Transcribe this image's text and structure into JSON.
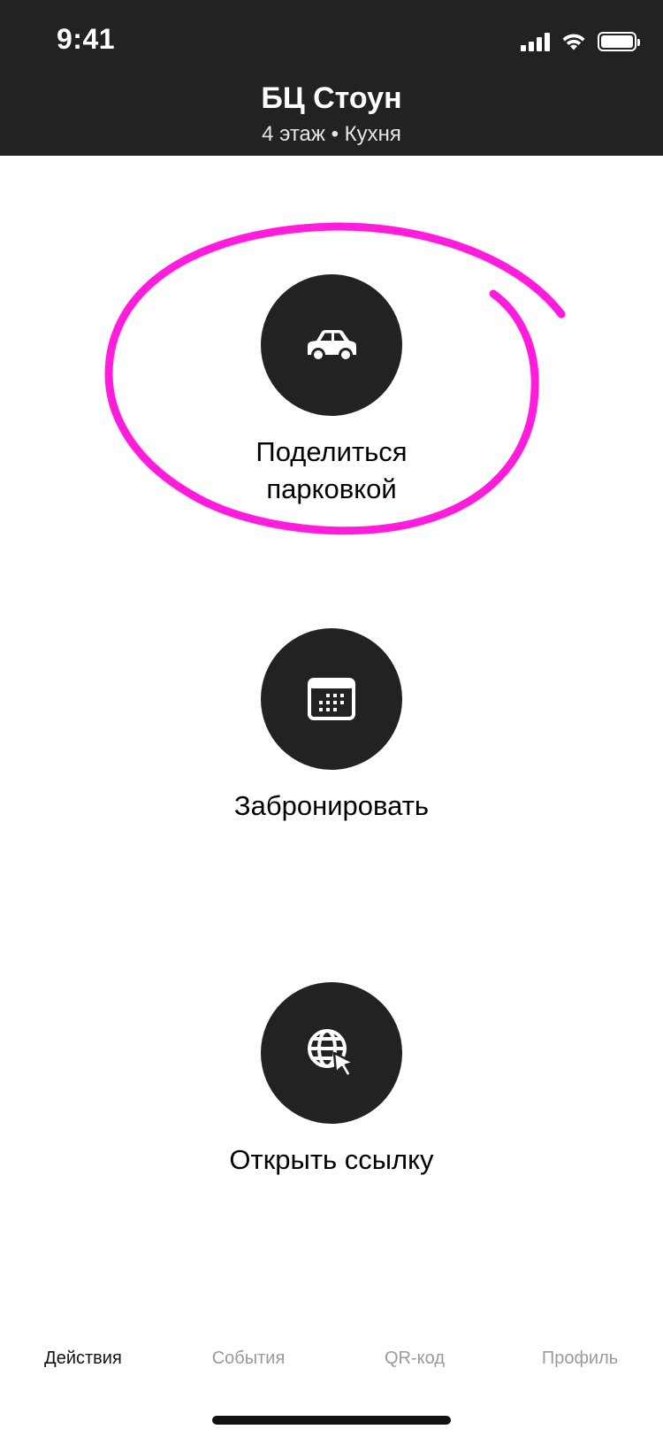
{
  "status_bar": {
    "time": "9:41"
  },
  "header": {
    "title": "БЦ Стоун",
    "subtitle": "4 этаж • Кухня"
  },
  "actions": [
    {
      "label": "Поделиться\nпарковкой",
      "icon": "car-icon"
    },
    {
      "label": "Забронировать",
      "icon": "calendar-icon"
    },
    {
      "label": "Открыть ссылку",
      "icon": "globe-cursor-icon"
    }
  ],
  "annotation": {
    "color": "#ff1cdc",
    "target": "share-parking-action"
  },
  "tabs": [
    {
      "label": "Действия",
      "active": true
    },
    {
      "label": "События",
      "active": false
    },
    {
      "label": "QR-код",
      "active": false
    },
    {
      "label": "Профиль",
      "active": false
    }
  ]
}
